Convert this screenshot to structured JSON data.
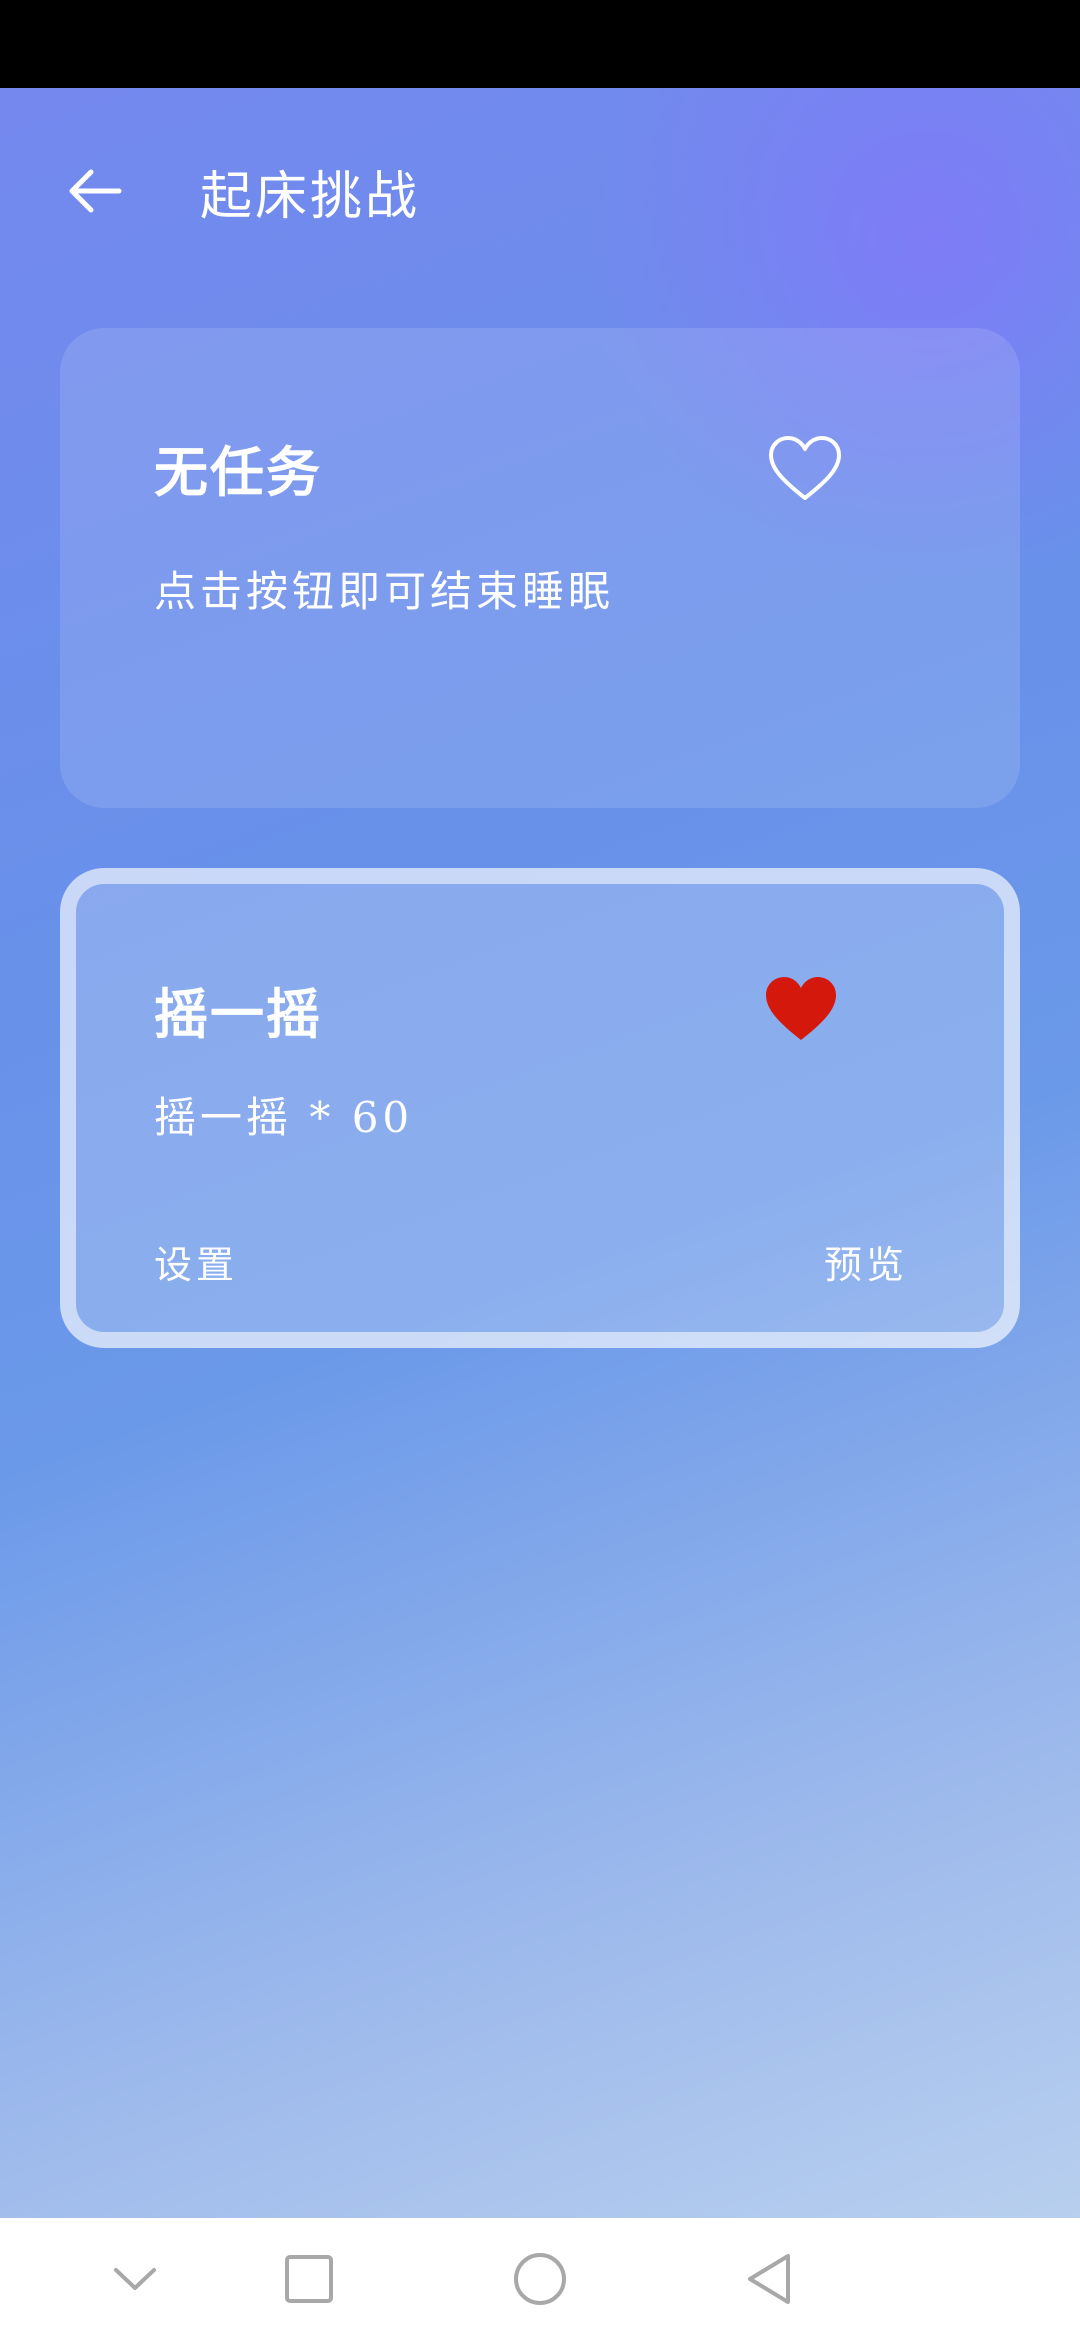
{
  "header": {
    "title": "起床挑战",
    "back_icon": "arrow-left-icon"
  },
  "cards": [
    {
      "title": "无任务",
      "description": "点击按钮即可结束睡眠",
      "favorite": false,
      "selected": false
    },
    {
      "title": "摇一摇",
      "description": "摇一摇 * 60",
      "favorite": true,
      "selected": true,
      "settings_label": "设置",
      "preview_label": "预览"
    }
  ],
  "nav": {
    "icons": [
      "chevron-down-icon",
      "square-icon",
      "circle-icon",
      "triangle-back-icon"
    ]
  },
  "colors": {
    "heart_active": "#d4190c",
    "nav_icon": "#a8a8a8"
  }
}
